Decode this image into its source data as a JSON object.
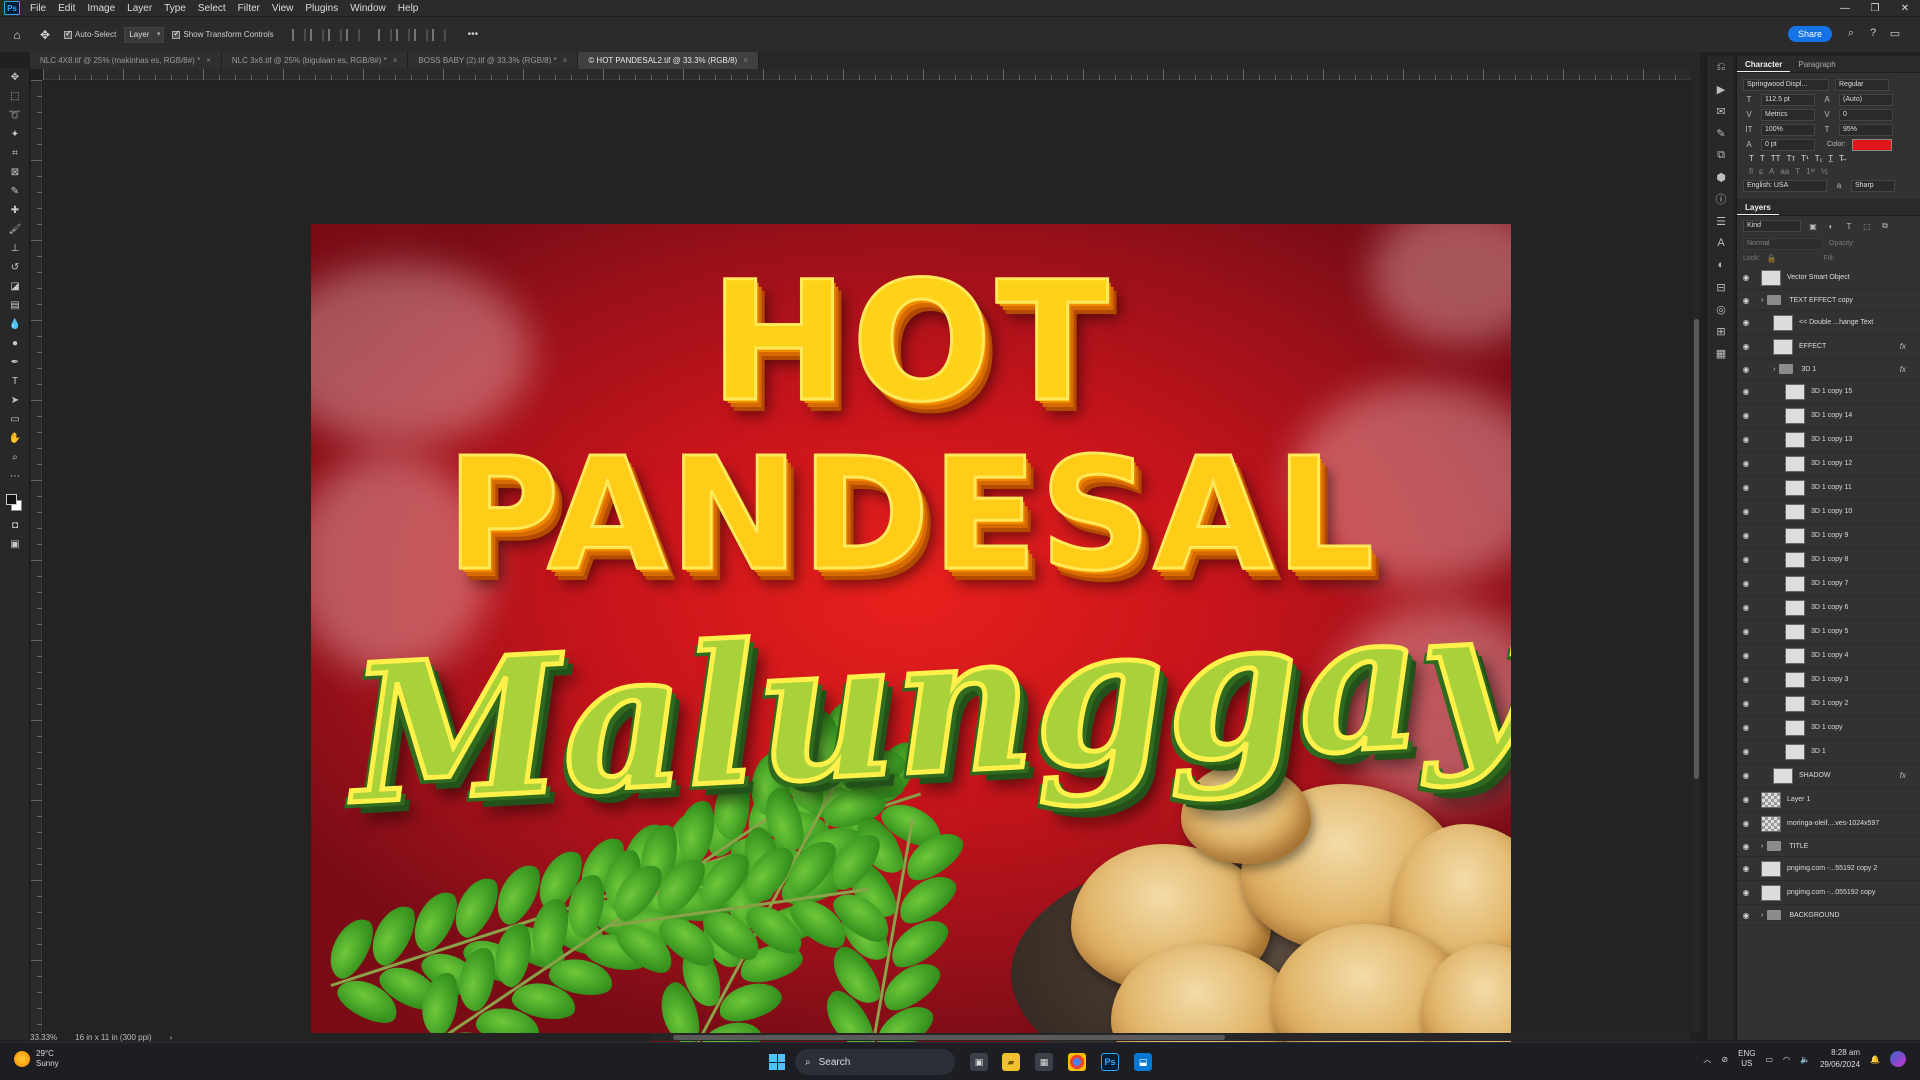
{
  "app": {
    "logo_text": "Ps"
  },
  "menu": [
    "File",
    "Edit",
    "Image",
    "Layer",
    "Type",
    "Select",
    "Filter",
    "View",
    "Plugins",
    "Window",
    "Help"
  ],
  "options": {
    "auto_select_label": "Auto-Select",
    "layer_select": "Layer",
    "transform_label": "Show Transform Controls",
    "more": "•••",
    "share_label": "Share"
  },
  "tabs": [
    {
      "label": "NLC 4X8.tif @ 25% (makinhas es, RGB/8#) *",
      "active": false
    },
    {
      "label": "NLC 3x6.tif @ 25% (bigulaan es, RGB/8#) *",
      "active": false
    },
    {
      "label": "BOSS BABY (2).tif @ 33.3% (RGB/8) *",
      "active": false
    },
    {
      "label": "© HOT PANDESAL2.tif @ 33.3% (RGB/8)",
      "active": true
    }
  ],
  "artwork": {
    "line1": "HOT",
    "line2": "PANDESAL",
    "line3": "Malunggay"
  },
  "status": {
    "zoom": "33.33%",
    "doc_size": "16 in x 11 in (300 ppi)",
    "arrow": "›"
  },
  "character": {
    "tab_character": "Character",
    "tab_paragraph": "Paragraph",
    "font_family": "Springwood Displ...",
    "font_style": "Regular",
    "font_size": "112.5 pt",
    "leading": "(Auto)",
    "kerning": "Metrics",
    "tracking": "0",
    "vscale": "100%",
    "hscale": "95%",
    "baseline": "0 pt",
    "color_label": "Color:",
    "color_value": "#e0161b",
    "language": "English: USA",
    "antialias": "Sharp"
  },
  "layers_panel": {
    "title": "Layers",
    "filter_kind": "Kind",
    "blend_mode": "Normal",
    "opacity_label": "Opacity:",
    "lock_label": "Lock:",
    "fill_label": "Fill:",
    "layers": [
      {
        "name": "Vector Smart Object",
        "type": "smart",
        "indent": 0,
        "fx": false
      },
      {
        "name": "TEXT EFFECT copy",
        "type": "group",
        "indent": 0,
        "fx": false
      },
      {
        "name": "<< Double ...hange Text",
        "type": "smart",
        "indent": 1,
        "fx": false
      },
      {
        "name": "EFFECT",
        "type": "smart",
        "indent": 1,
        "fx": true
      },
      {
        "name": "3D 1",
        "type": "group",
        "indent": 1,
        "fx": true
      },
      {
        "name": "3D 1 copy 15",
        "type": "smart",
        "indent": 2,
        "fx": false
      },
      {
        "name": "3D 1 copy 14",
        "type": "smart",
        "indent": 2,
        "fx": false
      },
      {
        "name": "3D 1 copy 13",
        "type": "smart",
        "indent": 2,
        "fx": false
      },
      {
        "name": "3D 1 copy 12",
        "type": "smart",
        "indent": 2,
        "fx": false
      },
      {
        "name": "3D 1 copy 11",
        "type": "smart",
        "indent": 2,
        "fx": false
      },
      {
        "name": "3D 1 copy 10",
        "type": "smart",
        "indent": 2,
        "fx": false
      },
      {
        "name": "3D 1 copy 9",
        "type": "smart",
        "indent": 2,
        "fx": false
      },
      {
        "name": "3D 1 copy 8",
        "type": "smart",
        "indent": 2,
        "fx": false
      },
      {
        "name": "3D 1 copy 7",
        "type": "smart",
        "indent": 2,
        "fx": false
      },
      {
        "name": "3D 1 copy 6",
        "type": "smart",
        "indent": 2,
        "fx": false
      },
      {
        "name": "3D 1 copy 5",
        "type": "smart",
        "indent": 2,
        "fx": false
      },
      {
        "name": "3D 1 copy 4",
        "type": "smart",
        "indent": 2,
        "fx": false
      },
      {
        "name": "3D 1 copy 3",
        "type": "smart",
        "indent": 2,
        "fx": false
      },
      {
        "name": "3D 1 copy 2",
        "type": "smart",
        "indent": 2,
        "fx": false
      },
      {
        "name": "3D 1 copy",
        "type": "smart",
        "indent": 2,
        "fx": false
      },
      {
        "name": "3D 1",
        "type": "smart",
        "indent": 2,
        "fx": false
      },
      {
        "name": "SHADOW",
        "type": "smart",
        "indent": 1,
        "fx": true
      },
      {
        "name": "Layer 1",
        "type": "pixel",
        "indent": 0,
        "fx": false
      },
      {
        "name": "moringa-oleif....ves-1024x597",
        "type": "pixel",
        "indent": 0,
        "fx": false
      },
      {
        "name": "TITLE",
        "type": "group",
        "indent": 0,
        "fx": false
      },
      {
        "name": "pngimg.com -...55192 copy 2",
        "type": "smart",
        "indent": 0,
        "fx": false
      },
      {
        "name": "pngimg.com -...055192 copy",
        "type": "smart",
        "indent": 0,
        "fx": false
      },
      {
        "name": "BACKGROUND",
        "type": "group",
        "indent": 0,
        "fx": false
      }
    ]
  },
  "taskbar": {
    "temp": "29°C",
    "weather": "Sunny",
    "search_label": "Search",
    "lang1": "ENG",
    "lang2": "US",
    "time": "8:28 am",
    "date": "29/06/2024"
  }
}
